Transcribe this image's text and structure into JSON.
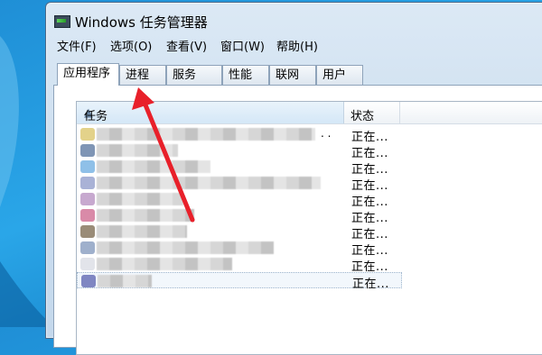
{
  "window": {
    "title": "Windows 任务管理器"
  },
  "menu": [
    "文件(F)",
    "选项(O)",
    "查看(V)",
    "窗口(W)",
    "帮助(H)"
  ],
  "tabs": [
    "应用程序",
    "进程",
    "服务",
    "性能",
    "联网",
    "用户"
  ],
  "active_tab": "应用程序",
  "table": {
    "columns": [
      "任务",
      "状态"
    ],
    "rows": [
      {
        "status": "正在...",
        "ellipsis": ". ."
      },
      {
        "status": "正在..."
      },
      {
        "status": "正在..."
      },
      {
        "status": "正在..."
      },
      {
        "status": "正在..."
      },
      {
        "status": "正在..."
      },
      {
        "status": "正在..."
      },
      {
        "status": "正在..."
      },
      {
        "status": "正在..."
      },
      {
        "status": "正在..."
      }
    ]
  },
  "icons": {
    "app": "task-manager-icon",
    "annotation": "red-arrow-pointing-to-processes-tab"
  },
  "colors": {
    "annotation_arrow": "#e8202a",
    "desktop": "#2aa6e8"
  }
}
